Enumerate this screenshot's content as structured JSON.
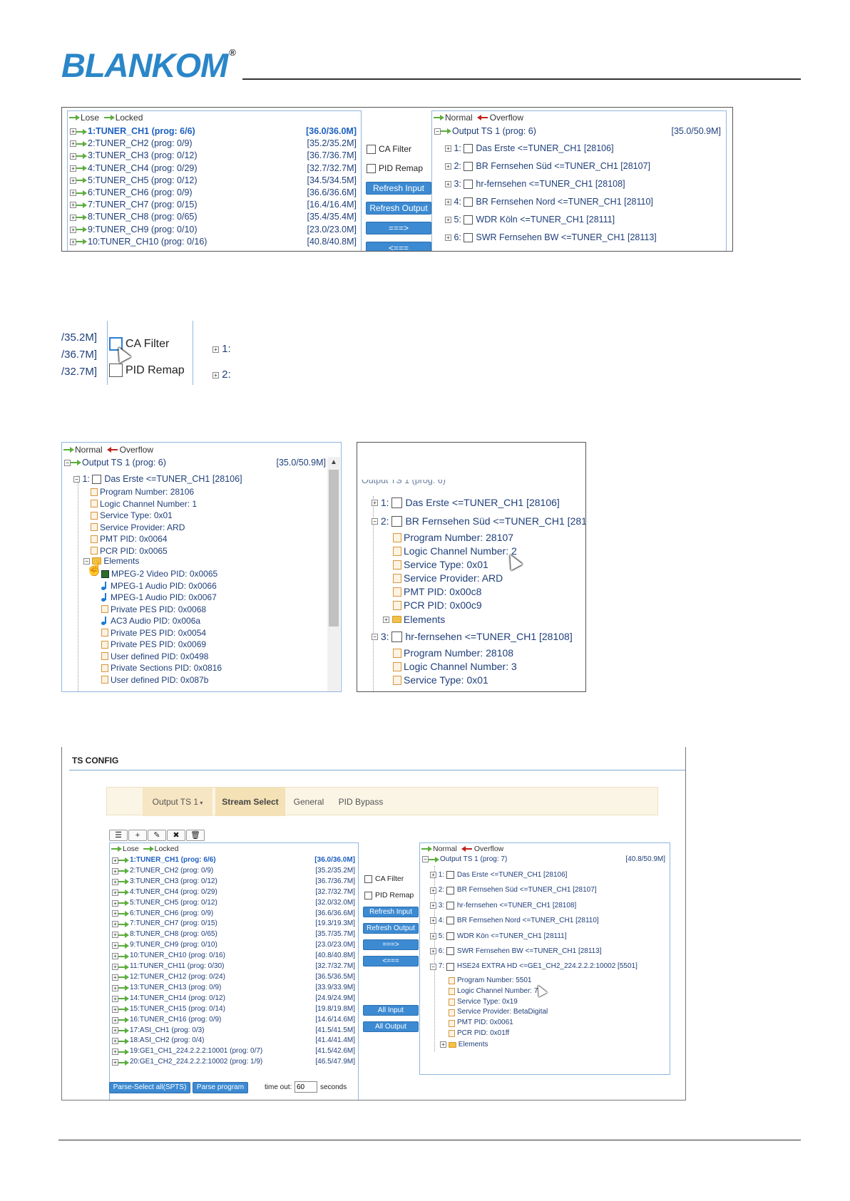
{
  "logo": {
    "text": "BLANKOM",
    "reg": "®"
  },
  "legend": {
    "lose": "Lose",
    "locked": "Locked",
    "normal": "Normal",
    "overflow": "Overflow"
  },
  "panel1": {
    "inputs": [
      {
        "label": "1:TUNER_CH1 (prog: 6/6)",
        "rate": "[36.0/36.0M]"
      },
      {
        "label": "2:TUNER_CH2 (prog: 0/9)",
        "rate": "[35.2/35.2M]"
      },
      {
        "label": "3:TUNER_CH3 (prog: 0/12)",
        "rate": "[36.7/36.7M]"
      },
      {
        "label": "4:TUNER_CH4 (prog: 0/29)",
        "rate": "[32.7/32.7M]"
      },
      {
        "label": "5:TUNER_CH5 (prog: 0/12)",
        "rate": "[34.5/34.5M]"
      },
      {
        "label": "6:TUNER_CH6 (prog: 0/9)",
        "rate": "[36.6/36.6M]"
      },
      {
        "label": "7:TUNER_CH7 (prog: 0/15)",
        "rate": "[16.4/16.4M]"
      },
      {
        "label": "8:TUNER_CH8 (prog: 0/65)",
        "rate": "[35.4/35.4M]"
      },
      {
        "label": "9:TUNER_CH9 (prog: 0/10)",
        "rate": "[23.0/23.0M]"
      },
      {
        "label": "10:TUNER_CH10 (prog: 0/16)",
        "rate": "[40.8/40.8M]"
      }
    ],
    "ca_filter": "CA Filter",
    "pid_remap": "PID Remap",
    "refresh_input": "Refresh Input",
    "refresh_output": "Refresh Output",
    "add": "===>",
    "remove": "<===",
    "output": {
      "title": "Output TS 1 (prog: 6)",
      "rate": "[35.0/50.9M]"
    },
    "programs": [
      {
        "num": "1:",
        "label": "Das Erste <=TUNER_CH1 [28106]"
      },
      {
        "num": "2:",
        "label": "BR Fernsehen Süd <=TUNER_CH1 [28107]"
      },
      {
        "num": "3:",
        "label": "hr-fernsehen <=TUNER_CH1 [28108]"
      },
      {
        "num": "4:",
        "label": "BR Fernsehen Nord <=TUNER_CH1 [28110]"
      },
      {
        "num": "5:",
        "label": "WDR Köln <=TUNER_CH1 [28111]"
      },
      {
        "num": "6:",
        "label": "SWR Fernsehen BW <=TUNER_CH1 [28113]"
      }
    ]
  },
  "zoom": {
    "rates": [
      "/35.2M]",
      "/36.7M]",
      "/32.7M]"
    ],
    "ca_filter": "CA Filter",
    "pid_remap": "PID Remap",
    "nums": [
      "1:",
      "2:"
    ]
  },
  "panel3": {
    "output": {
      "title": "Output TS 1 (prog: 6)",
      "rate": "[35.0/50.9M]"
    },
    "program": {
      "num": "1:",
      "label": "Das Erste <=TUNER_CH1 [28106]"
    },
    "details": [
      "Program Number: 28106",
      "Logic Channel Number: 1",
      "Service Type: 0x01",
      "Service Provider: ARD",
      "PMT PID: 0x0064",
      "PCR PID: 0x0065"
    ],
    "elements_label": "Elements",
    "elements": [
      {
        "icon": "video",
        "text": "MPEG-2 Video PID: 0x0065"
      },
      {
        "icon": "audio",
        "text": "MPEG-1 Audio PID: 0x0066"
      },
      {
        "icon": "audio",
        "text": "MPEG-1 Audio PID: 0x0067"
      },
      {
        "icon": "doc",
        "text": "Private PES PID: 0x0068"
      },
      {
        "icon": "audio",
        "text": "AC3 Audio PID: 0x006a"
      },
      {
        "icon": "doc",
        "text": "Private PES PID: 0x0054"
      },
      {
        "icon": "doc",
        "text": "Private PES PID: 0x0069"
      },
      {
        "icon": "doc",
        "text": "User defined PID: 0x0498"
      },
      {
        "icon": "doc",
        "text": "Private Sections PID: 0x0816"
      },
      {
        "icon": "doc",
        "text": "User defined PID: 0x087b"
      }
    ]
  },
  "panel4": {
    "output_title": "Output TS 1 (prog: 6)",
    "p1": {
      "num": "1:",
      "label": "Das Erste <=TUNER_CH1 [28106]"
    },
    "p2": {
      "num": "2:",
      "label": "BR Fernsehen Süd <=TUNER_CH1 [28107]"
    },
    "p2_details": [
      "Program Number: 28107",
      "Logic Channel Number: 2",
      "Service Type: 0x01",
      "Service Provider: ARD",
      "PMT PID: 0x00c8",
      "PCR PID: 0x00c9"
    ],
    "elements_label": "Elements",
    "p3": {
      "num": "3:",
      "label": "hr-fernsehen <=TUNER_CH1 [28108]"
    },
    "p3_details": [
      "Program Number: 28108",
      "Logic Channel Number: 3",
      "Service Type: 0x01"
    ]
  },
  "tsconfig": {
    "title": "TS CONFIG",
    "tabs": {
      "output": "Output TS 1",
      "stream_select": "Stream Select",
      "general": "General",
      "pid_bypass": "PID Bypass"
    },
    "toolbar": {
      "list": "☰",
      "add": "+",
      "edit": "✎",
      "delete": "✖",
      "trash": "🗑"
    },
    "inputs": [
      {
        "label": "1:TUNER_CH1 (prog: 6/6)",
        "rate": "[36.0/36.0M]"
      },
      {
        "label": "2:TUNER_CH2 (prog: 0/9)",
        "rate": "[35.2/35.2M]"
      },
      {
        "label": "3:TUNER_CH3 (prog: 0/12)",
        "rate": "[36.7/36.7M]"
      },
      {
        "label": "4:TUNER_CH4 (prog: 0/29)",
        "rate": "[32.7/32.7M]"
      },
      {
        "label": "5:TUNER_CH5 (prog: 0/12)",
        "rate": "[32.0/32.0M]"
      },
      {
        "label": "6:TUNER_CH6 (prog: 0/9)",
        "rate": "[36.6/36.6M]"
      },
      {
        "label": "7:TUNER_CH7 (prog: 0/15)",
        "rate": "[19.3/19.3M]"
      },
      {
        "label": "8:TUNER_CH8 (prog: 0/65)",
        "rate": "[35.7/35.7M]"
      },
      {
        "label": "9:TUNER_CH9 (prog: 0/10)",
        "rate": "[23.0/23.0M]"
      },
      {
        "label": "10:TUNER_CH10 (prog: 0/16)",
        "rate": "[40.8/40.8M]"
      },
      {
        "label": "11:TUNER_CH11 (prog: 0/30)",
        "rate": "[32.7/32.7M]"
      },
      {
        "label": "12:TUNER_CH12 (prog: 0/24)",
        "rate": "[36.5/36.5M]"
      },
      {
        "label": "13:TUNER_CH13 (prog: 0/9)",
        "rate": "[33.9/33.9M]"
      },
      {
        "label": "14:TUNER_CH14 (prog: 0/12)",
        "rate": "[24.9/24.9M]"
      },
      {
        "label": "15:TUNER_CH15 (prog: 0/14)",
        "rate": "[19.8/19.8M]"
      },
      {
        "label": "16:TUNER_CH16 (prog: 0/9)",
        "rate": "[14.6/14.6M]"
      },
      {
        "label": "17:ASI_CH1 (prog: 0/3)",
        "rate": "[41.5/41.5M]"
      },
      {
        "label": "18:ASI_CH2 (prog: 0/4)",
        "rate": "[41.4/41.4M]"
      },
      {
        "label": "19:GE1_CH1_224.2.2.2:10001 (prog: 0/7)",
        "rate": "[41.5/42.6M]"
      },
      {
        "label": "20:GE1_CH2_224.2.2.2:10002 (prog: 1/9)",
        "rate": "[46.5/47.9M]"
      }
    ],
    "ca_filter": "CA Filter",
    "pid_remap": "PID Remap",
    "refresh_input": "Refresh Input",
    "refresh_output": "Refresh Output",
    "add": "===>",
    "remove": "<===",
    "all_input": "All Input",
    "all_output": "All Output",
    "output": {
      "title": "Output TS 1 (prog: 7)",
      "rate": "[40.8/50.9M]"
    },
    "programs": [
      {
        "num": "1:",
        "label": "Das Erste <=TUNER_CH1 [28106]"
      },
      {
        "num": "2:",
        "label": "BR Fernsehen Süd <=TUNER_CH1 [28107]"
      },
      {
        "num": "3:",
        "label": "hr-fernsehen <=TUNER_CH1 [28108]"
      },
      {
        "num": "4:",
        "label": "BR Fernsehen Nord <=TUNER_CH1 [28110]"
      },
      {
        "num": "5:",
        "label": "WDR Kön <=TUNER_CH1 [28111]"
      },
      {
        "num": "6:",
        "label": "SWR Fernsehen BW <=TUNER_CH1 [28113]"
      },
      {
        "num": "7:",
        "label": "HSE24 EXTRA HD <=GE1_CH2_224.2.2.2:10002 [5501]"
      }
    ],
    "p7_details": [
      "Program Number: 5501",
      "Logic Channel Number: 7",
      "Service Type: 0x19",
      "Service Provider: BetaDigital",
      "PMT PID: 0x0061",
      "PCR PID: 0x01ff"
    ],
    "elements_label": "Elements",
    "parse_all": "Parse-Select all(SPTS)",
    "parse_program": "Parse program",
    "timeout_label": "time out:",
    "timeout_value": "60",
    "seconds": "seconds"
  }
}
